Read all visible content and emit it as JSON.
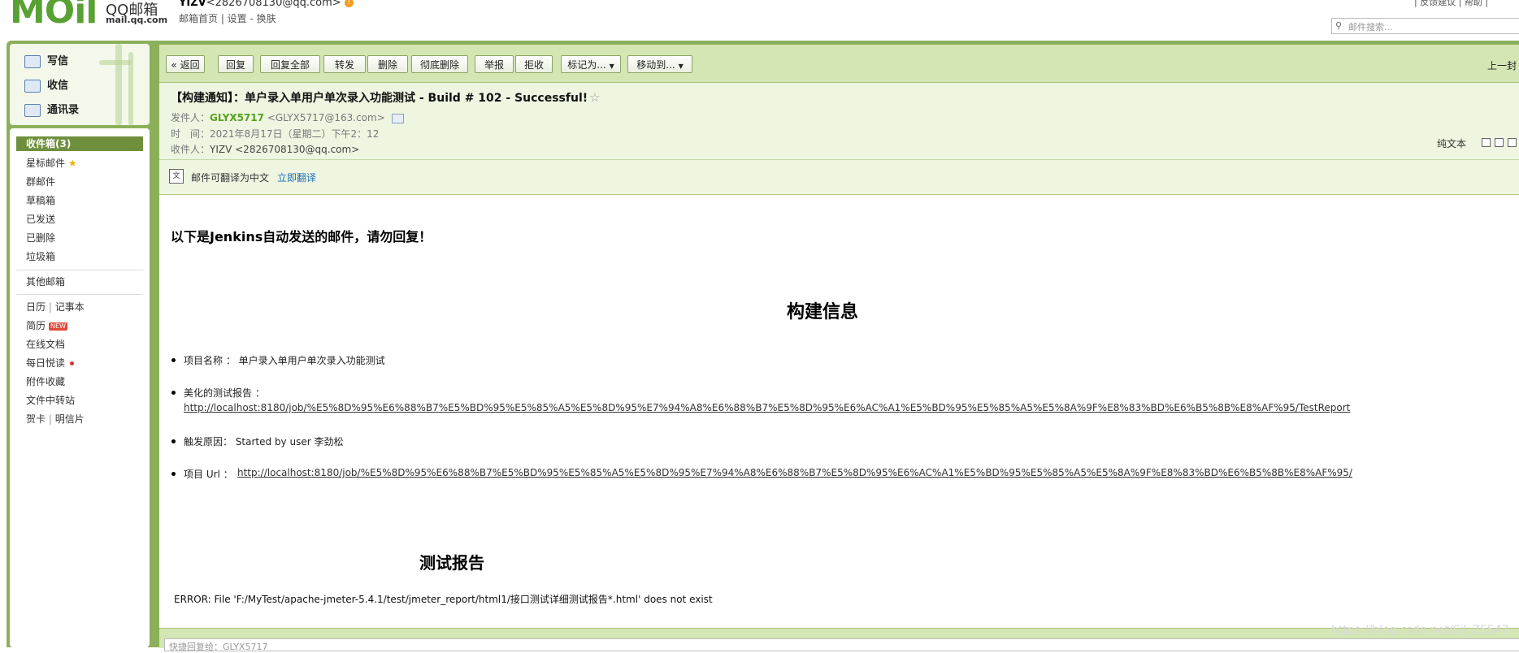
{
  "header": {
    "logo_text": "MOil",
    "logo_cn": "QQ邮箱",
    "logo_domain": "mail.qq.com",
    "user_name": "YIZV",
    "user_email": "<2826708130@qq.com>",
    "user_nav": "邮箱首页 | 设置 - 换肤",
    "top_links": "| 反馈建议 | 帮助 |",
    "search_placeholder": "邮件搜索..."
  },
  "left_top": {
    "compose": "写信",
    "receive": "收信",
    "contacts": "通讯录"
  },
  "folders": {
    "inbox": "收件箱(3)",
    "starred": "星标邮件",
    "group": "群邮件",
    "drafts": "草稿箱",
    "sent": "已发送",
    "deleted": "已删除",
    "junk": "垃圾箱",
    "other": "其他邮箱",
    "calendar": "日历",
    "notes": "记事本",
    "resume": "简历",
    "resume_badge": "NEW",
    "docs": "在线文档",
    "daily": "每日悦读",
    "attachments": "附件收藏",
    "transfer": "文件中转站",
    "cards": "贺卡",
    "postcard": "明信片",
    "divider": "|"
  },
  "toolbar": {
    "back": "« 返回",
    "reply": "回复",
    "reply_all": "回复全部",
    "forward": "转发",
    "delete": "删除",
    "delete_perm": "彻底删除",
    "report": "举报",
    "reject": "拒收",
    "mark_as": "标记为...",
    "move_to": "移动到...",
    "prev_mail": "上一封"
  },
  "mail": {
    "subject": "【构建通知】：单户录入单用户单次录入功能测试 - Build # 102 - Successful!",
    "sender_label": "发件人：",
    "sender_name": "GLYX5717",
    "sender_email": "<GLYX5717@163.com>",
    "time_label": "时　间：",
    "time_value": "2021年8月17日（星期二）下午2：12",
    "recipient_label": "收件人：",
    "recipient_value": "YIZV <2826708130@qq.com>",
    "plain_text": "纯文本",
    "translate_text": "邮件可翻译为中文",
    "translate_link": "立即翻译"
  },
  "body": {
    "intro": "以下是Jenkins自动发送的邮件，请勿回复！",
    "build_heading": "构建信息",
    "project_name": "项目名称 ： 单户录入单用户单次录入功能测试",
    "report_label": "美化的测试报告 ：",
    "report_url": "http://localhost:8180/job/%E5%8D%95%E6%88%B7%E5%BD%95%E5%85%A5%E5%8D%95%E7%94%A8%E6%88%B7%E5%8D%95%E6%AC%A1%E5%BD%95%E5%85%A5%E5%8A%9F%E8%83%BD%E6%B5%8B%E8%AF%95/TestReport",
    "trigger": "触发原因： Started by user 李劲松",
    "url_label": "项目 Url ：",
    "project_url": "http://localhost:8180/job/%E5%8D%95%E6%88%B7%E5%BD%95%E5%85%A5%E5%8D%95%E7%94%A8%E6%88%B7%E5%8D%95%E6%AC%A1%E5%BD%95%E5%85%A5%E5%8A%9F%E8%83%BD%E6%B5%8B%E8%AF%95/",
    "report_heading": "测试报告",
    "error": "ERROR: File 'F:/MyTest/apache-jmeter-5.4.1/test/jmeter_report/html1/接口测试详细测试报告*.html' does not exist"
  },
  "reply": {
    "placeholder": "快捷回复给：GLYX5717"
  },
  "watermark": "https://blog.csdn.net/Sil_Z5547",
  "colors": {
    "frame_green": "#8cb05a",
    "toolbar_green": "#d5e6b5",
    "header_green": "#eef5e1",
    "inbox_active": "#6f8f3d",
    "sender_green": "#56a11e"
  }
}
